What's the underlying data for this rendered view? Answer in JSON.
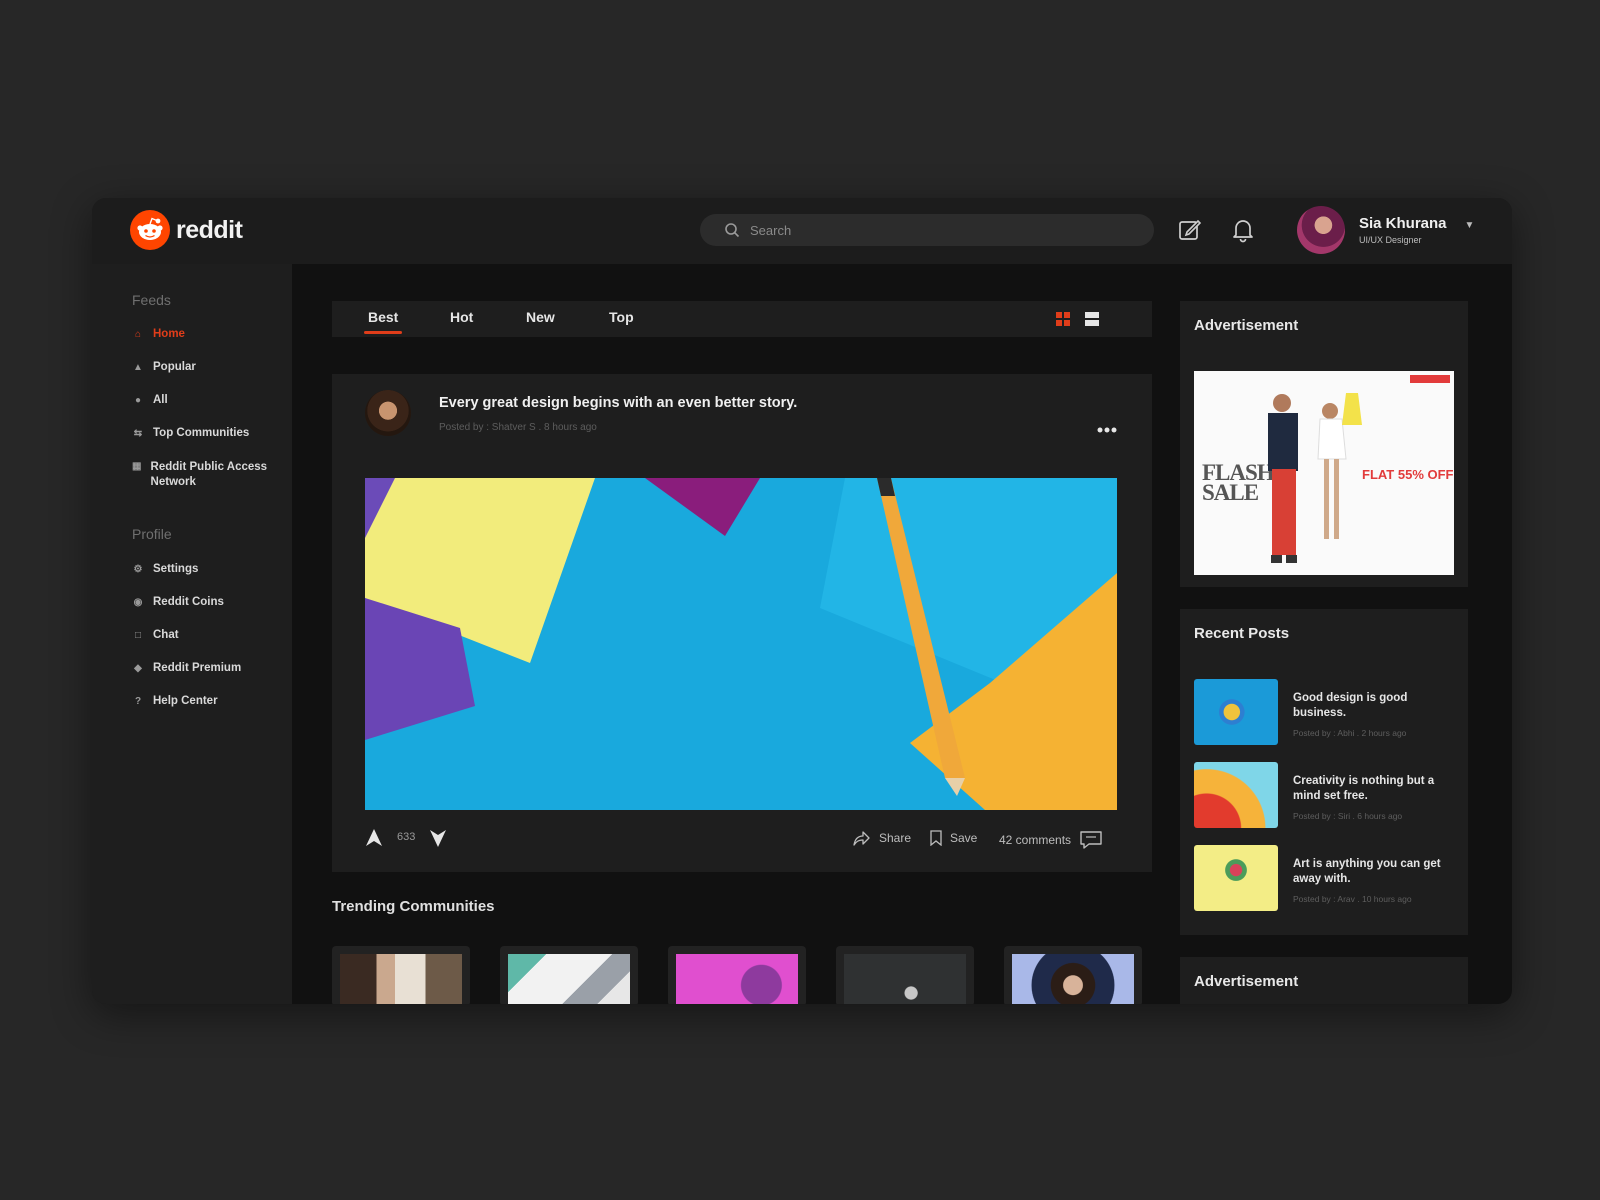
{
  "brand": {
    "name": "reddit",
    "accent": "#ff4500"
  },
  "search": {
    "placeholder": "Search",
    "icon": "search-icon"
  },
  "header": {
    "icons": [
      "edit-icon",
      "bell-icon"
    ],
    "user": {
      "name": "Sia Khurana",
      "role": "UI/UX Designer"
    }
  },
  "sidebar": {
    "feeds_title": "Feeds",
    "feeds": [
      {
        "label": "Home",
        "icon": "home-icon",
        "active": true
      },
      {
        "label": "Popular",
        "icon": "flame-icon"
      },
      {
        "label": "All",
        "icon": "globe-icon"
      },
      {
        "label": "Top Communities",
        "icon": "arrows-icon"
      },
      {
        "label": "Reddit Public Access Network",
        "icon": "grid-icon"
      }
    ],
    "profile_title": "Profile",
    "profile": [
      {
        "label": "Settings",
        "icon": "gear-icon"
      },
      {
        "label": "Reddit Coins",
        "icon": "coin-icon"
      },
      {
        "label": "Chat",
        "icon": "chat-icon"
      },
      {
        "label": "Reddit Premium",
        "icon": "shield-icon"
      },
      {
        "label": "Help Center",
        "icon": "help-icon"
      }
    ]
  },
  "tabs": [
    {
      "label": "Best",
      "active": true
    },
    {
      "label": "Hot"
    },
    {
      "label": "New"
    },
    {
      "label": "Top"
    }
  ],
  "view_toggle": [
    "card-view-icon",
    "list-view-icon"
  ],
  "post": {
    "title": "Every great design begins with an even better story.",
    "meta": "Posted by : Shatver S . 8 hours ago",
    "votes": "633",
    "share": "Share",
    "save": "Save",
    "comments": "42 comments"
  },
  "trending": {
    "title": "Trending Communities"
  },
  "ad": {
    "title": "Advertisement",
    "headline_line1": "FLASH",
    "headline_line2": "SALE",
    "offer": "FLAT 55% OFF"
  },
  "recent": {
    "title": "Recent Posts",
    "items": [
      {
        "text": "Good design is good business.",
        "meta": "Posted by : Abhi . 2 hours ago"
      },
      {
        "text": "Creativity is nothing but a mind set free.",
        "meta": "Posted by : Siri . 6 hours ago"
      },
      {
        "text": "Art is anything you can get away with.",
        "meta": "Posted by : Arav . 10 hours ago"
      }
    ]
  },
  "ad2": {
    "title": "Advertisement"
  }
}
